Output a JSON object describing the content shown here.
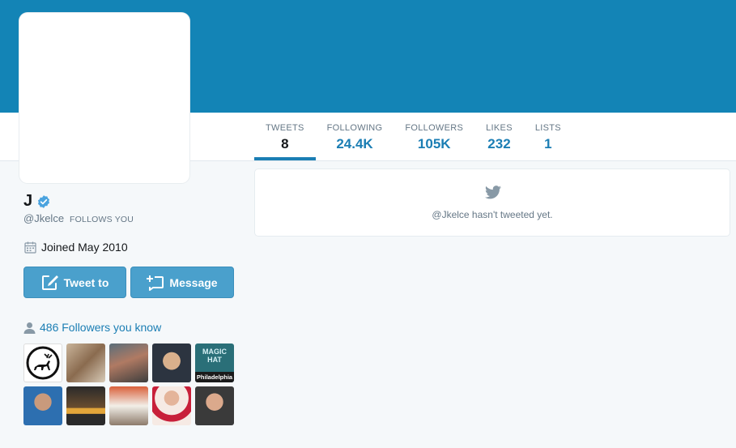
{
  "profile": {
    "name": "J",
    "handle": "@Jkelce",
    "follows_you": "FOLLOWS YOU",
    "joined": "Joined May 2010"
  },
  "stats": [
    {
      "label": "TWEETS",
      "value": "8"
    },
    {
      "label": "FOLLOWING",
      "value": "24.4K"
    },
    {
      "label": "FOLLOWERS",
      "value": "105K"
    },
    {
      "label": "LIKES",
      "value": "232"
    },
    {
      "label": "LISTS",
      "value": "1"
    }
  ],
  "buttons": {
    "tweet_to": "Tweet to",
    "message": "Message"
  },
  "followers_you_know": "486 Followers you know",
  "thumbnails": {
    "magic_hat_top": "MAGIC HAT",
    "magic_hat_bottom": "Philadelphia"
  },
  "timeline": {
    "empty_message": "@Jkelce hasn't tweeted yet."
  },
  "colors": {
    "banner": "#1384b6",
    "accent": "#1b7eb4",
    "button": "#4aa0cc"
  },
  "icons": [
    "verified-badge-icon",
    "calendar-icon",
    "compose-icon",
    "message-icon",
    "user-icon",
    "twitter-bird-icon"
  ]
}
